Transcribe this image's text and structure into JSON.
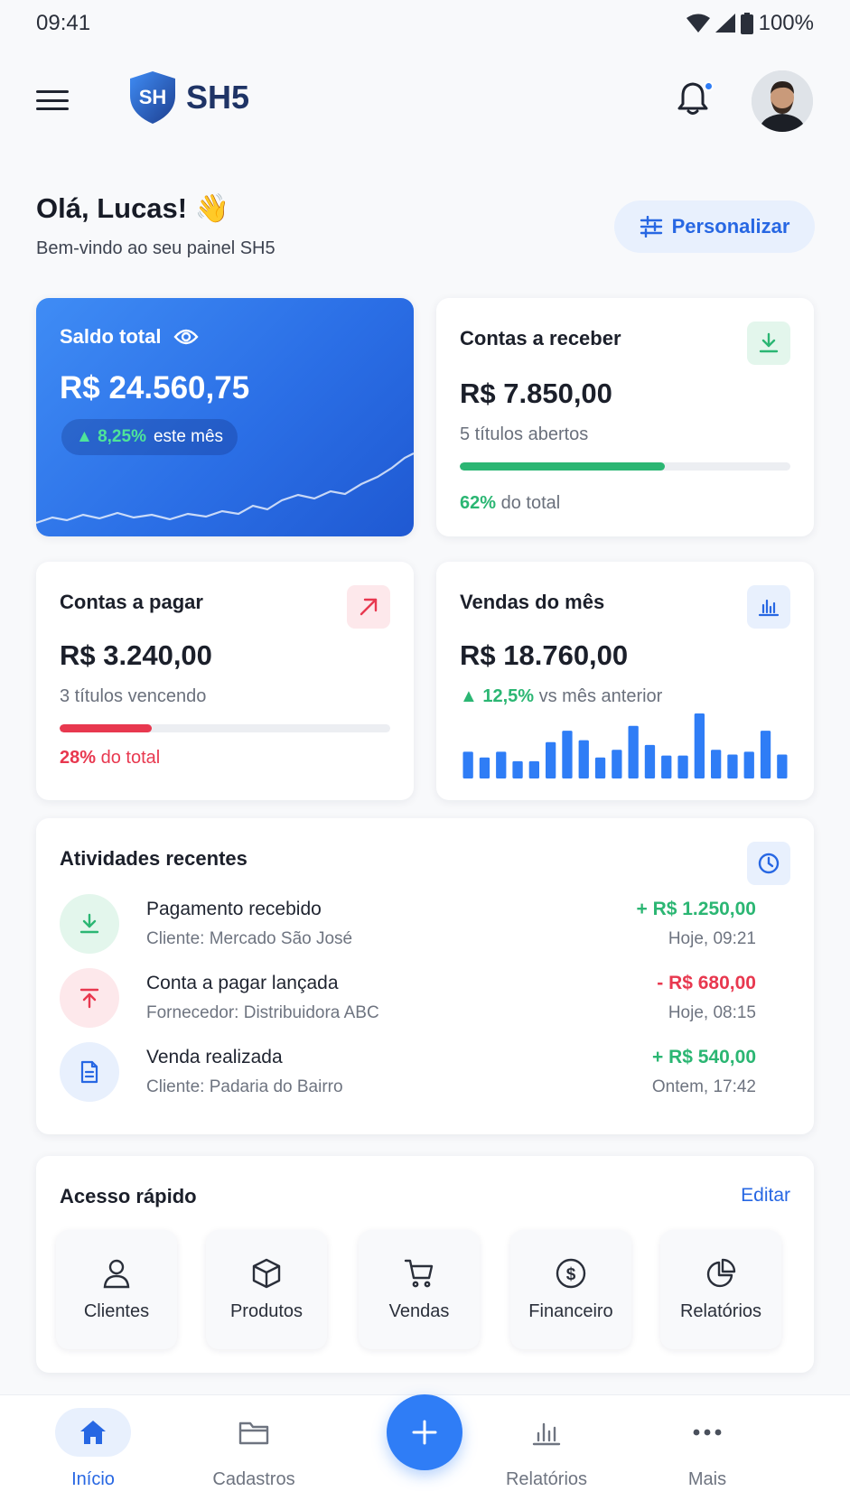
{
  "status_bar": {
    "time": "09:41",
    "battery": "100%"
  },
  "header": {
    "brand": "SH5",
    "logo_letters": "SH",
    "notification_dot_color": "#2f7df6"
  },
  "greeting": {
    "title": "Olá, Lucas! 👋",
    "subtitle": "Bem-vindo ao seu painel SH5"
  },
  "personalize_label": "Personalizar",
  "balance_card": {
    "title": "Saldo total",
    "amount": "R$ 24.560,75",
    "change": "▲ 8,25%",
    "change_suffix": "este mês"
  },
  "receivable_card": {
    "title": "Contas a receber",
    "amount": "R$ 7.850,00",
    "subtitle": "5 títulos abertos",
    "percent_label": "62%",
    "percent_suffix": "do total",
    "progress": 0.62,
    "color": "#2bb673"
  },
  "payable_card": {
    "title": "Contas a pagar",
    "amount": "R$ 3.240,00",
    "subtitle": "3 títulos vencendo",
    "percent_label": "28%",
    "percent_suffix": "do total",
    "progress": 0.28,
    "color": "#e8384f"
  },
  "sales_card": {
    "title": "Vendas do mês",
    "amount": "R$ 18.760,00",
    "change": "▲ 12,5%",
    "change_suffix": "vs mês anterior",
    "bars": [
      28,
      22,
      28,
      18,
      18,
      38,
      50,
      40,
      22,
      30,
      55,
      35,
      24,
      24,
      68,
      30,
      25,
      28,
      50,
      25
    ]
  },
  "activities": {
    "title": "Atividades recentes",
    "items": [
      {
        "title": "Pagamento recebido",
        "desc": "Cliente: Mercado São José",
        "amount": "+ R$ 1.250,00",
        "time": "Hoje, 09:21",
        "type": "in",
        "icon": "download-icon"
      },
      {
        "title": "Conta a pagar lançada",
        "desc": "Fornecedor: Distribuidora ABC",
        "amount": "- R$ 680,00",
        "time": "Hoje, 08:15",
        "type": "out",
        "icon": "upload-icon"
      },
      {
        "title": "Venda realizada",
        "desc": "Cliente: Padaria do Bairro",
        "amount": "+ R$ 540,00",
        "time": "Ontem, 17:42",
        "type": "sale",
        "icon": "document-icon"
      }
    ]
  },
  "quick_access": {
    "title": "Acesso rápido",
    "edit_label": "Editar",
    "items": [
      {
        "label": "Clientes",
        "icon": "user-icon"
      },
      {
        "label": "Produtos",
        "icon": "box-icon"
      },
      {
        "label": "Vendas",
        "icon": "cart-icon"
      },
      {
        "label": "Financeiro",
        "icon": "dollar-icon"
      },
      {
        "label": "Relatórios",
        "icon": "pie-chart-icon"
      }
    ]
  },
  "bottom_nav": {
    "items": [
      {
        "label": "Início",
        "icon": "home-icon",
        "active": true
      },
      {
        "label": "Cadastros",
        "icon": "folder-icon",
        "active": false
      },
      {
        "label": "Relatórios",
        "icon": "bar-chart-icon",
        "active": false
      },
      {
        "label": "Mais",
        "icon": "more-icon",
        "active": false
      }
    ],
    "fab_icon": "plus-icon"
  },
  "colors": {
    "primary": "#2f7df6",
    "positive": "#2bb673",
    "negative": "#e8384f"
  }
}
